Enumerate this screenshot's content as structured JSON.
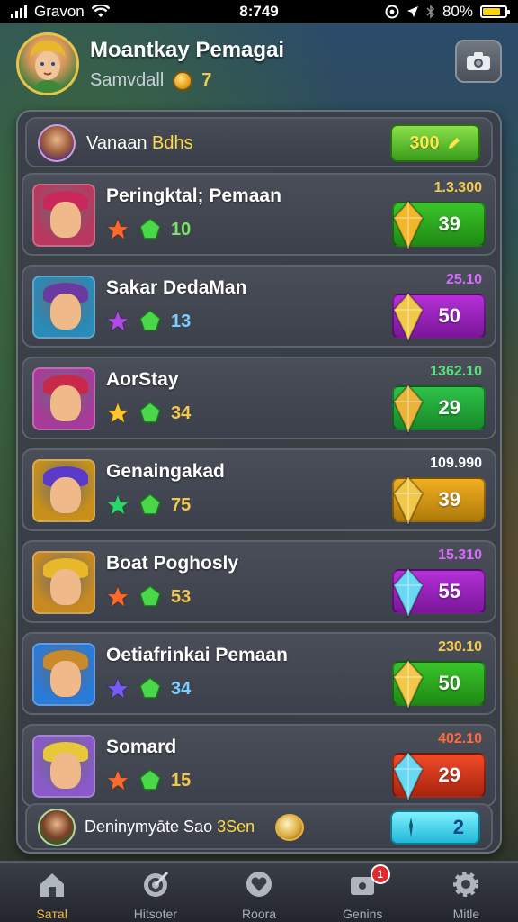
{
  "status_bar": {
    "carrier": "Gravon",
    "time": "8:749",
    "battery": "80%",
    "battery_level": 0.8
  },
  "profile": {
    "name": "Moantkay Pemagai",
    "subtitle": "Samvdall",
    "level": "7",
    "camera_icon": "camera-icon"
  },
  "panel_header": {
    "title_main": "Vanaan ",
    "title_highlight": "Bdhs",
    "button_value": "300"
  },
  "players": [
    {
      "name": "Peringktal; Pemaan",
      "stat": "10",
      "score": "1.3.300",
      "value": "39",
      "star_color": "#ff6a2a",
      "stat_color": "#7de26a",
      "score_color": "#f2c94c",
      "btn_color": "#39c52a",
      "btn_dark": "#1f8a14",
      "gem_color": "#f2b62a",
      "avatar_bg": "#b9385f",
      "hair_color": "#c8285a"
    },
    {
      "name": "Sakar DedaMan",
      "stat": "13",
      "score": "25.10",
      "value": "50",
      "star_color": "#b04ae8",
      "stat_color": "#7ad0ff",
      "score_color": "#d86aff",
      "btn_color": "#b530d8",
      "btn_dark": "#7a169a",
      "gem_color": "#f2c84a",
      "avatar_bg": "#2a8ab8",
      "hair_color": "#6a3aa0"
    },
    {
      "name": "AorStay",
      "stat": "34",
      "score": "1362.10",
      "value": "29",
      "star_color": "#ffc82a",
      "stat_color": "#f2c94c",
      "score_color": "#5ae07a",
      "btn_color": "#2ec248",
      "btn_dark": "#178a2a",
      "gem_color": "#e8b43a",
      "avatar_bg": "#a83a9a",
      "hair_color": "#c8284a"
    },
    {
      "name": "Genaingakad",
      "stat": "75",
      "score": "109.990",
      "value": "39",
      "star_color": "#2ad86a",
      "stat_color": "#f2c94c",
      "score_color": "#ffffff",
      "btn_color": "#f2b020",
      "btn_dark": "#b07a0a",
      "gem_color": "#f2c84a",
      "avatar_bg": "#c8901a",
      "hair_color": "#5a3ac8"
    },
    {
      "name": "Boat Poghosly",
      "stat": "53",
      "score": "15.310",
      "value": "55",
      "star_color": "#ff6a2a",
      "stat_color": "#f2c94c",
      "score_color": "#d86aff",
      "btn_color": "#b530d8",
      "btn_dark": "#7a169a",
      "gem_color": "#6ad8f2",
      "avatar_bg": "#c88a20",
      "hair_color": "#e8b82a"
    },
    {
      "name": "Oetiafrinkai Pemaan",
      "stat": "34",
      "score": "230.10",
      "value": "50",
      "star_color": "#7a5aff",
      "stat_color": "#7ad0ff",
      "score_color": "#f2c94c",
      "btn_color": "#39c52a",
      "btn_dark": "#1f8a14",
      "gem_color": "#f2c84a",
      "avatar_bg": "#2a7ad8",
      "hair_color": "#c88a2a"
    },
    {
      "name": "Somard",
      "stat": "15",
      "score": "402.10",
      "value": "29",
      "star_color": "#ff6a2a",
      "stat_color": "#f2c94c",
      "score_color": "#ff6a3a",
      "btn_color": "#f24a2a",
      "btn_dark": "#a8240e",
      "gem_color": "#6ad8f2",
      "avatar_bg": "#8a5ac8",
      "hair_color": "#e8c83a"
    }
  ],
  "panel_footer": {
    "text_main": "Deninymyāte Sao ",
    "text_highlight": "3Sen",
    "button_value": "2"
  },
  "nav": [
    {
      "label": "Saтal",
      "icon": "home-icon",
      "active": true
    },
    {
      "label": "Hitsoter",
      "icon": "target-icon",
      "active": false
    },
    {
      "label": "Roora",
      "icon": "heart-icon",
      "active": false
    },
    {
      "label": "Genins",
      "icon": "chest-icon",
      "active": false,
      "badge": "1"
    },
    {
      "label": "Mitle",
      "icon": "gear-icon",
      "active": false
    }
  ]
}
